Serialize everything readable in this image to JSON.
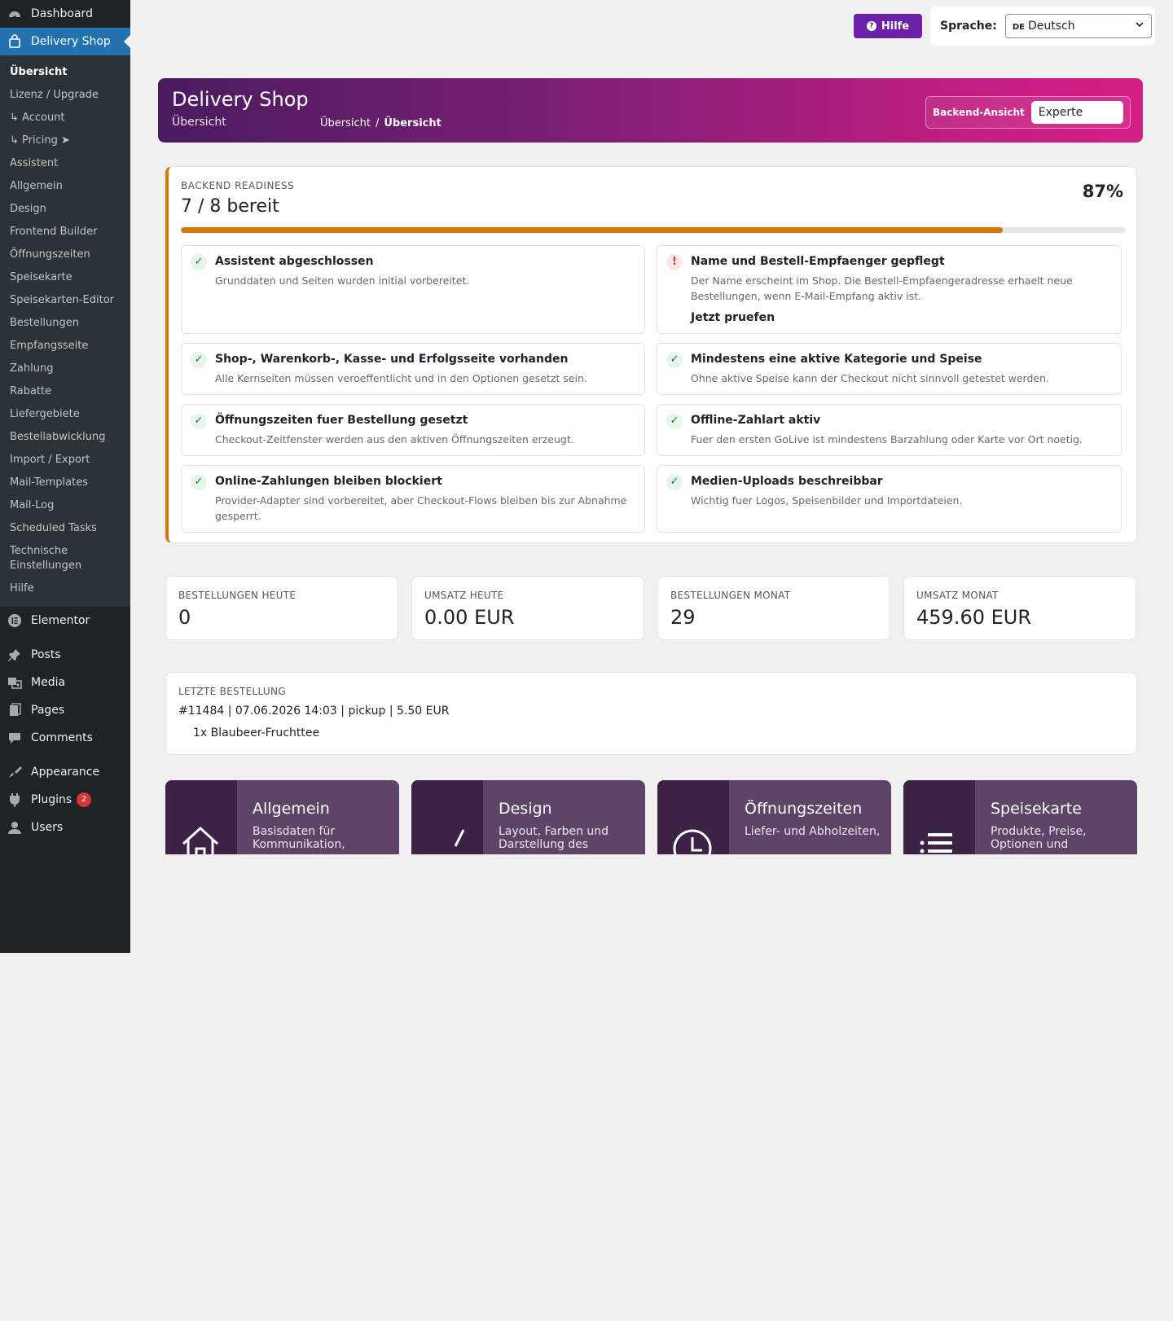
{
  "sidebar": {
    "dashboard": "Dashboard",
    "plugin": "Delivery Shop",
    "submenu": [
      "Übersicht",
      "Lizenz / Upgrade",
      "↳ Account",
      "↳ Pricing ➤",
      "Assistent",
      "Allgemein",
      "Design",
      "Frontend Builder",
      "Öffnungszeiten",
      "Speisekarte",
      "Speisekarten-Editor",
      "Bestellungen",
      "Empfangsseite",
      "Zahlung",
      "Rabatte",
      "Liefergebiete",
      "Bestellabwicklung",
      "Import / Export",
      "Mail-Templates",
      "Mail-Log",
      "Scheduled Tasks",
      "Technische Einstellungen",
      "Hilfe"
    ],
    "elementor": "Elementor",
    "posts": "Posts",
    "media": "Media",
    "pages": "Pages",
    "comments": "Comments",
    "appearance": "Appearance",
    "plugins": "Plugins",
    "plugins_badge": "2",
    "users": "Users"
  },
  "topbar": {
    "help": "Hilfe",
    "language_label": "Sprache:",
    "language_code": "DE",
    "language_value": "Deutsch"
  },
  "hero": {
    "title": "Delivery Shop",
    "subtitle": "Übersicht",
    "breadcrumb_1": "Übersicht",
    "breadcrumb_sep": "/",
    "breadcrumb_2": "Übersicht",
    "view_label": "Backend-Ansicht",
    "view_value": "Experte"
  },
  "readiness": {
    "kicker": "BACKEND READINESS",
    "count": "7 / 8 bereit",
    "percent": "87%",
    "progress": 87,
    "checks": [
      {
        "title": "Assistent abgeschlossen",
        "desc": "Grunddaten und Seiten wurden initial vorbereitet.",
        "status": "✓"
      },
      {
        "title": "Name und Bestell-Empfaenger gepflegt",
        "desc": "Der Name erscheint im Shop. Die Bestell-Empfaengeradresse erhaelt neue Bestellungen, wenn E-Mail-Empfang aktiv ist.",
        "status": "!",
        "link": "Jetzt pruefen"
      },
      {
        "title": "Shop-, Warenkorb-, Kasse- und Erfolgsseite vorhanden",
        "desc": "Alle Kernseiten müssen veroeffentlicht und in den Optionen gesetzt sein.",
        "status": "✓"
      },
      {
        "title": "Mindestens eine aktive Kategorie und Speise",
        "desc": "Ohne aktive Speise kann der Checkout nicht sinnvoll getestet werden.",
        "status": "✓"
      },
      {
        "title": "Öffnungszeiten fuer Bestellung gesetzt",
        "desc": "Checkout-Zeitfenster werden aus den aktiven Öffnungszeiten erzeugt.",
        "status": "✓"
      },
      {
        "title": "Offline-Zahlart aktiv",
        "desc": "Fuer den ersten GoLive ist mindestens Barzahlung oder Karte vor Ort noetig.",
        "status": "✓"
      },
      {
        "title": "Online-Zahlungen bleiben blockiert",
        "desc": "Provider-Adapter sind vorbereitet, aber Checkout-Flows bleiben bis zur Abnahme gesperrt.",
        "status": "✓"
      },
      {
        "title": "Medien-Uploads beschreibbar",
        "desc": "Wichtig fuer Logos, Speisenbilder und Importdateien.",
        "status": "✓"
      }
    ]
  },
  "stats": [
    {
      "label": "BESTELLUNGEN HEUTE",
      "value": "0"
    },
    {
      "label": "UMSATZ HEUTE",
      "value": "0.00 EUR"
    },
    {
      "label": "BESTELLUNGEN MONAT",
      "value": "29"
    },
    {
      "label": "UMSATZ MONAT",
      "value": "459.60 EUR"
    }
  ],
  "last_order": {
    "label": "LETZTE BESTELLUNG",
    "line": "#11484 | 07.06.2026 14:03 | pickup | 5.50 EUR",
    "item": "1x Blaubeer-Fruchttee"
  },
  "tiles": [
    {
      "title": "Allgemein",
      "desc": "Basisdaten für Kommunikation,",
      "icon": "house-icon"
    },
    {
      "title": "Design",
      "desc": "Layout, Farben und Darstellung des",
      "icon": "brush-icon"
    },
    {
      "title": "Öffnungszeiten",
      "desc": "Liefer- und Abholzeiten,",
      "icon": "clock-icon"
    },
    {
      "title": "Speisekarte",
      "desc": "Produkte, Preise, Optionen und",
      "icon": "list-icon"
    }
  ],
  "colors": {
    "accent": "#6b21a8",
    "progress": "#d97706",
    "sidebar_bg": "#1d2327",
    "active_menu": "#2271b1",
    "ok": "#15803d",
    "warn": "#d63638"
  }
}
